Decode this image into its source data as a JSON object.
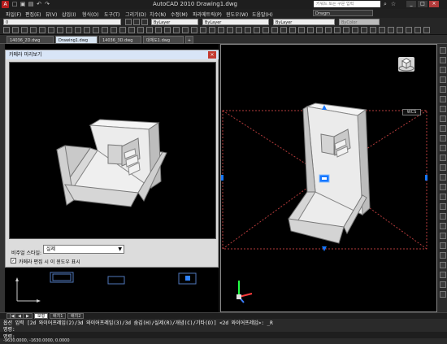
{
  "app": {
    "logo": "A",
    "title": "AutoCAD 2010   Drawing1.dwg",
    "search_placeholder": "키워드 또는 구문 입력",
    "workspace": "Drwgm"
  },
  "menus": [
    "파일(F)",
    "편집(E)",
    "뷰(V)",
    "삽입(I)",
    "형식(O)",
    "도구(T)",
    "그리기(D)",
    "치수(N)",
    "수정(M)",
    "파라메트릭(P)",
    "윈도우(W)",
    "도움말(H)"
  ],
  "toolbar": {
    "layer_value": "0",
    "color_value": "ByLayer",
    "linetype_value": "ByLayer",
    "lineweight_value": "ByLayer",
    "plotstyle_value": "ByColor"
  },
  "tabs": [
    {
      "label": "14036_2D.dwg"
    },
    {
      "label": "Drawing1.dwg"
    },
    {
      "label": "14036_3D.dwg"
    },
    {
      "label": "대체도1.dwg"
    }
  ],
  "tabs_new": "+",
  "dialog": {
    "title": "카메라 미리보기",
    "close_label": "×",
    "visual_style_label": "비주얼 스타일:",
    "visual_style_value": "실제",
    "checkbox_checked": "✓",
    "checkbox_label": "카메라 편집 시 이 윈도우 표시"
  },
  "viewcube": {
    "wcs_label": "WCS"
  },
  "bottom_tabs": [
    {
      "label": "모형"
    },
    {
      "label": "배치1"
    },
    {
      "label": "배치2"
    }
  ],
  "command": {
    "history": "옵션 입력 [2d 와이어프레임(2)/3d 와이어프레임(3)/3d 숨김(H)/실제(R)/개념(C)/기타(O)] <2d 와이어프레임>: _R",
    "prompt1": "명령:",
    "prompt2": "명령:"
  },
  "status": {
    "coordinates": "-9630.0000, -1630.0000, 0.0000"
  },
  "colors": {
    "accent_red": "#b51d1d",
    "selection_blue": "#1677ff",
    "dialog_title_blue": "#d8e5f7",
    "dashed_red": "#b33b3b"
  }
}
